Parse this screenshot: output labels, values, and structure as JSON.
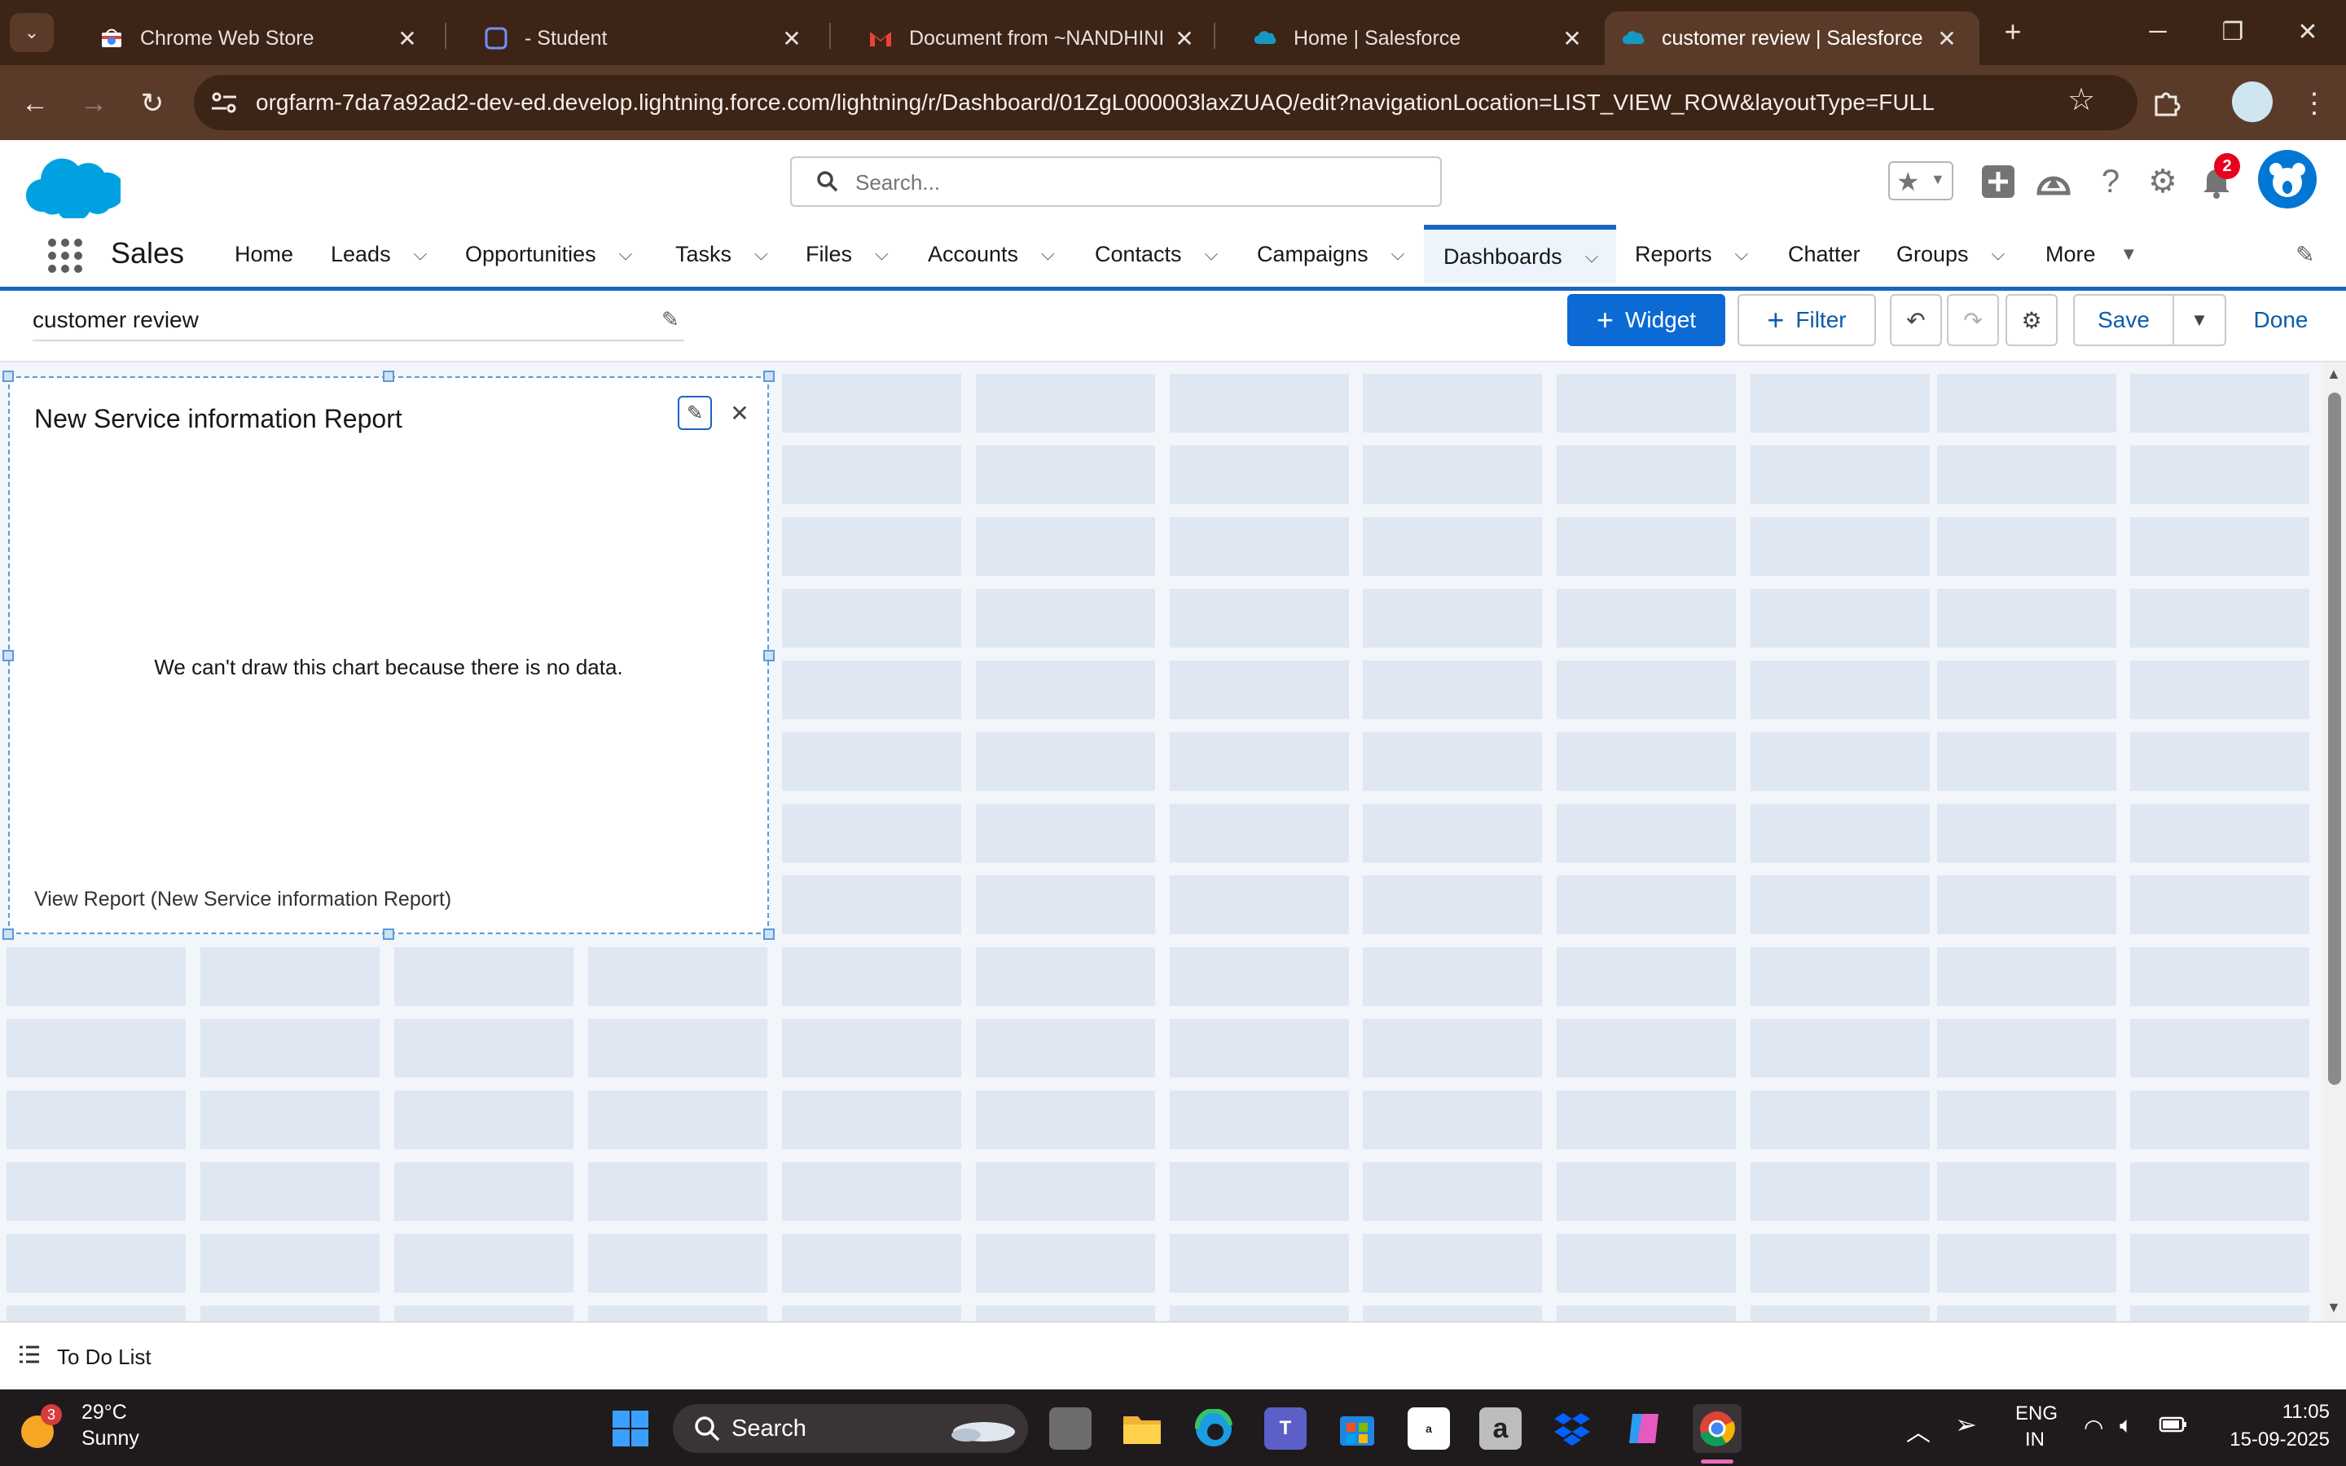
{
  "browser": {
    "tabs": [
      {
        "title": "Chrome Web Store",
        "icon": "chrome-web-store-icon"
      },
      {
        "title": "- Student",
        "icon": "student-app-icon"
      },
      {
        "title": "Document from ~NANDHINI ~",
        "icon": "gmail-icon"
      },
      {
        "title": "Home | Salesforce",
        "icon": "salesforce-cloud-icon"
      },
      {
        "title": "customer review | Salesforce",
        "icon": "salesforce-cloud-icon"
      }
    ],
    "new_tab": "+",
    "url": "orgfarm-7da7a92ad2-dev-ed.develop.lightning.force.com/lightning/r/Dashboard/01ZgL000003laxZUAQ/edit?navigationLocation=LIST_VIEW_ROW&layoutType=FULL"
  },
  "header": {
    "search_placeholder": "Search...",
    "notification_count": "2"
  },
  "nav": {
    "app_name": "Sales",
    "items": [
      {
        "label": "Home",
        "menu": false
      },
      {
        "label": "Leads",
        "menu": true
      },
      {
        "label": "Opportunities",
        "menu": true
      },
      {
        "label": "Tasks",
        "menu": true
      },
      {
        "label": "Files",
        "menu": true
      },
      {
        "label": "Accounts",
        "menu": true
      },
      {
        "label": "Contacts",
        "menu": true
      },
      {
        "label": "Campaigns",
        "menu": true
      },
      {
        "label": "Dashboards",
        "menu": true,
        "active": true
      },
      {
        "label": "Reports",
        "menu": true
      },
      {
        "label": "Chatter",
        "menu": false
      },
      {
        "label": "Groups",
        "menu": true
      },
      {
        "label": "More",
        "menu": true
      }
    ]
  },
  "toolbar": {
    "dashboard_name": "customer review",
    "widget_label": "Widget",
    "filter_label": "Filter",
    "save_label": "Save",
    "done_label": "Done"
  },
  "widget": {
    "title": "New Service information Report",
    "empty_message": "We can't draw this chart because there is no data.",
    "footer_link": "View Report (New Service information Report)"
  },
  "footer": {
    "todo_label": "To Do List"
  },
  "taskbar": {
    "weather_badge": "3",
    "temperature": "29°C",
    "condition": "Sunny",
    "search_label": "Search",
    "language": "ENG",
    "region": "IN",
    "time": "11:05",
    "date": "15-09-2025"
  },
  "colors": {
    "brand_blue": "#0b6ad3",
    "nav_underline": "#1b65c2",
    "chrome_frame": "#3c2417",
    "grid_cell": "#dfe7f2"
  }
}
